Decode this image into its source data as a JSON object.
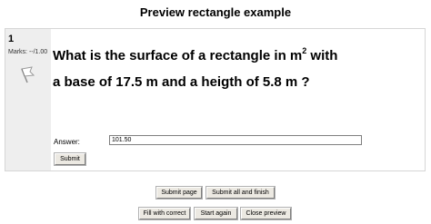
{
  "page": {
    "title": "Preview rectangle example"
  },
  "question": {
    "number": "1",
    "marks": "Marks: --/1.00",
    "text_line1_before_sup": "What is the surface of a rectangle in m",
    "text_sup": "2",
    "text_line1_after_sup": " with",
    "text_line2": "a base of 17.5 m and a heigth of 5.8 m ?",
    "flag_icon": "flag-icon"
  },
  "answer": {
    "label": "Answer:",
    "value": "101.50"
  },
  "buttons": {
    "submit": "Submit",
    "submit_page": "Submit page",
    "submit_all": "Submit all and finish",
    "fill_correct": "Fill with correct",
    "start_again": "Start again",
    "close_preview": "Close preview"
  }
}
